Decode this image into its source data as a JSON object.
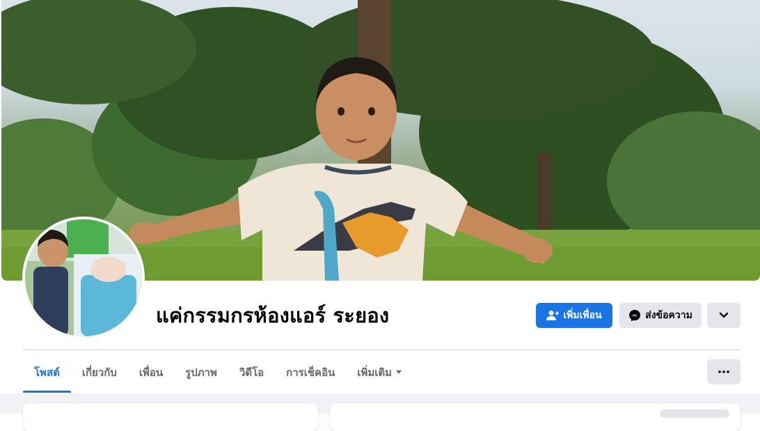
{
  "profile": {
    "name": "แค่กรรมกรห้องแอร์ ระยอง"
  },
  "actions": {
    "add_friend_label": "เพิ่มเพื่อน",
    "message_label": "ส่งข้อความ",
    "add_friend_icon": "person-plus-icon",
    "message_icon": "messenger-icon",
    "chevron_icon": "chevron-down-icon",
    "more_icon": "ellipsis-icon"
  },
  "tabs": [
    {
      "label": "โพสต์",
      "active": true
    },
    {
      "label": "เกี่ยวกับ",
      "active": false
    },
    {
      "label": "เพื่อน",
      "active": false
    },
    {
      "label": "รูปภาพ",
      "active": false
    },
    {
      "label": "วิดีโอ",
      "active": false
    },
    {
      "label": "การเช็คอิน",
      "active": false
    },
    {
      "label": "เพิ่มเติม",
      "active": false
    }
  ],
  "colors": {
    "accent": "#1b74e4",
    "secondary_button": "#e4e6eb",
    "text_primary": "#050505",
    "text_secondary": "#65676b",
    "feed_background": "#f0f2f5"
  }
}
